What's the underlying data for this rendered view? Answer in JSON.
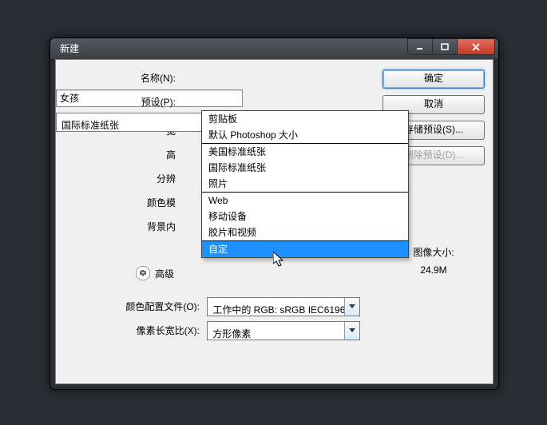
{
  "window": {
    "title": "新建"
  },
  "buttons": {
    "ok": "确定",
    "cancel": "取消",
    "save_preset": "存储预设(S)...",
    "delete_preset": "删除预设(D)..."
  },
  "labels": {
    "name": "名称(N):",
    "preset": "预设(P):",
    "width_partial": "宽",
    "height_partial": "高",
    "resolution_partial": "分辨",
    "color_mode_partial": "颜色模",
    "background_partial": "背景内",
    "advanced": "高级",
    "color_profile": "颜色配置文件(O):",
    "pixel_aspect": "像素长宽比(X):"
  },
  "values": {
    "name": "女孩",
    "preset": "国际标准纸张",
    "color_profile": "工作中的 RGB: sRGB IEC6196...",
    "pixel_aspect": "方形像素"
  },
  "image_size": {
    "label": "图像大小:",
    "value": "24.9M"
  },
  "preset_options": {
    "group1": [
      "剪贴板",
      "默认 Photoshop 大小"
    ],
    "group2": [
      "美国标准纸张",
      "国际标准纸张",
      "照片"
    ],
    "group3": [
      "Web",
      "移动设备",
      "胶片和视频"
    ],
    "group4": [
      "自定"
    ]
  }
}
